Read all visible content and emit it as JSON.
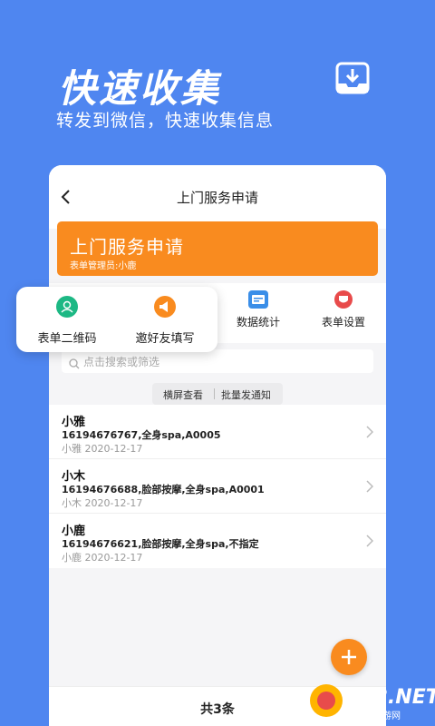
{
  "hero": {
    "title": "快速收集",
    "subtitle": "转发到微信，快速收集信息"
  },
  "header": {
    "title": "上门服务申请"
  },
  "banner": {
    "title": "上门服务申请",
    "admin": "表单管理员:小鹿"
  },
  "actions": [
    {
      "label": "数据统计",
      "icon": "chart-icon",
      "color": "#3a8ee8"
    },
    {
      "label": "表单设置",
      "icon": "settings-icon",
      "color": "#e84b4b"
    }
  ],
  "popup": [
    {
      "label": "表单二维码",
      "icon": "qrcode-icon",
      "color": "#1db884"
    },
    {
      "label": "邀好友填写",
      "icon": "megaphone-icon",
      "color": "#f98b1f"
    }
  ],
  "search": {
    "placeholder": "点击搜索或筛选"
  },
  "tools": {
    "landscape": "横屏查看",
    "batch": "批量发通知"
  },
  "records": [
    {
      "name": "小雅",
      "detail": "16194676767,全身spa,A0005",
      "meta": "小雅 2020-12-17"
    },
    {
      "name": "小木",
      "detail": "16194676688,脸部按摩,全身spa,A0001",
      "meta": "小木 2020-12-17"
    },
    {
      "name": "小鹿",
      "detail": "16194676621,脸部按摩,全身spa,不指定",
      "meta": "小鹿 2020-12-17"
    }
  ],
  "footer": {
    "count": "共3条"
  },
  "watermark": {
    "text": "962.NET",
    "sub": "乐游网"
  },
  "colors": {
    "background": "#4f86f0",
    "accent": "#f98b1f"
  }
}
